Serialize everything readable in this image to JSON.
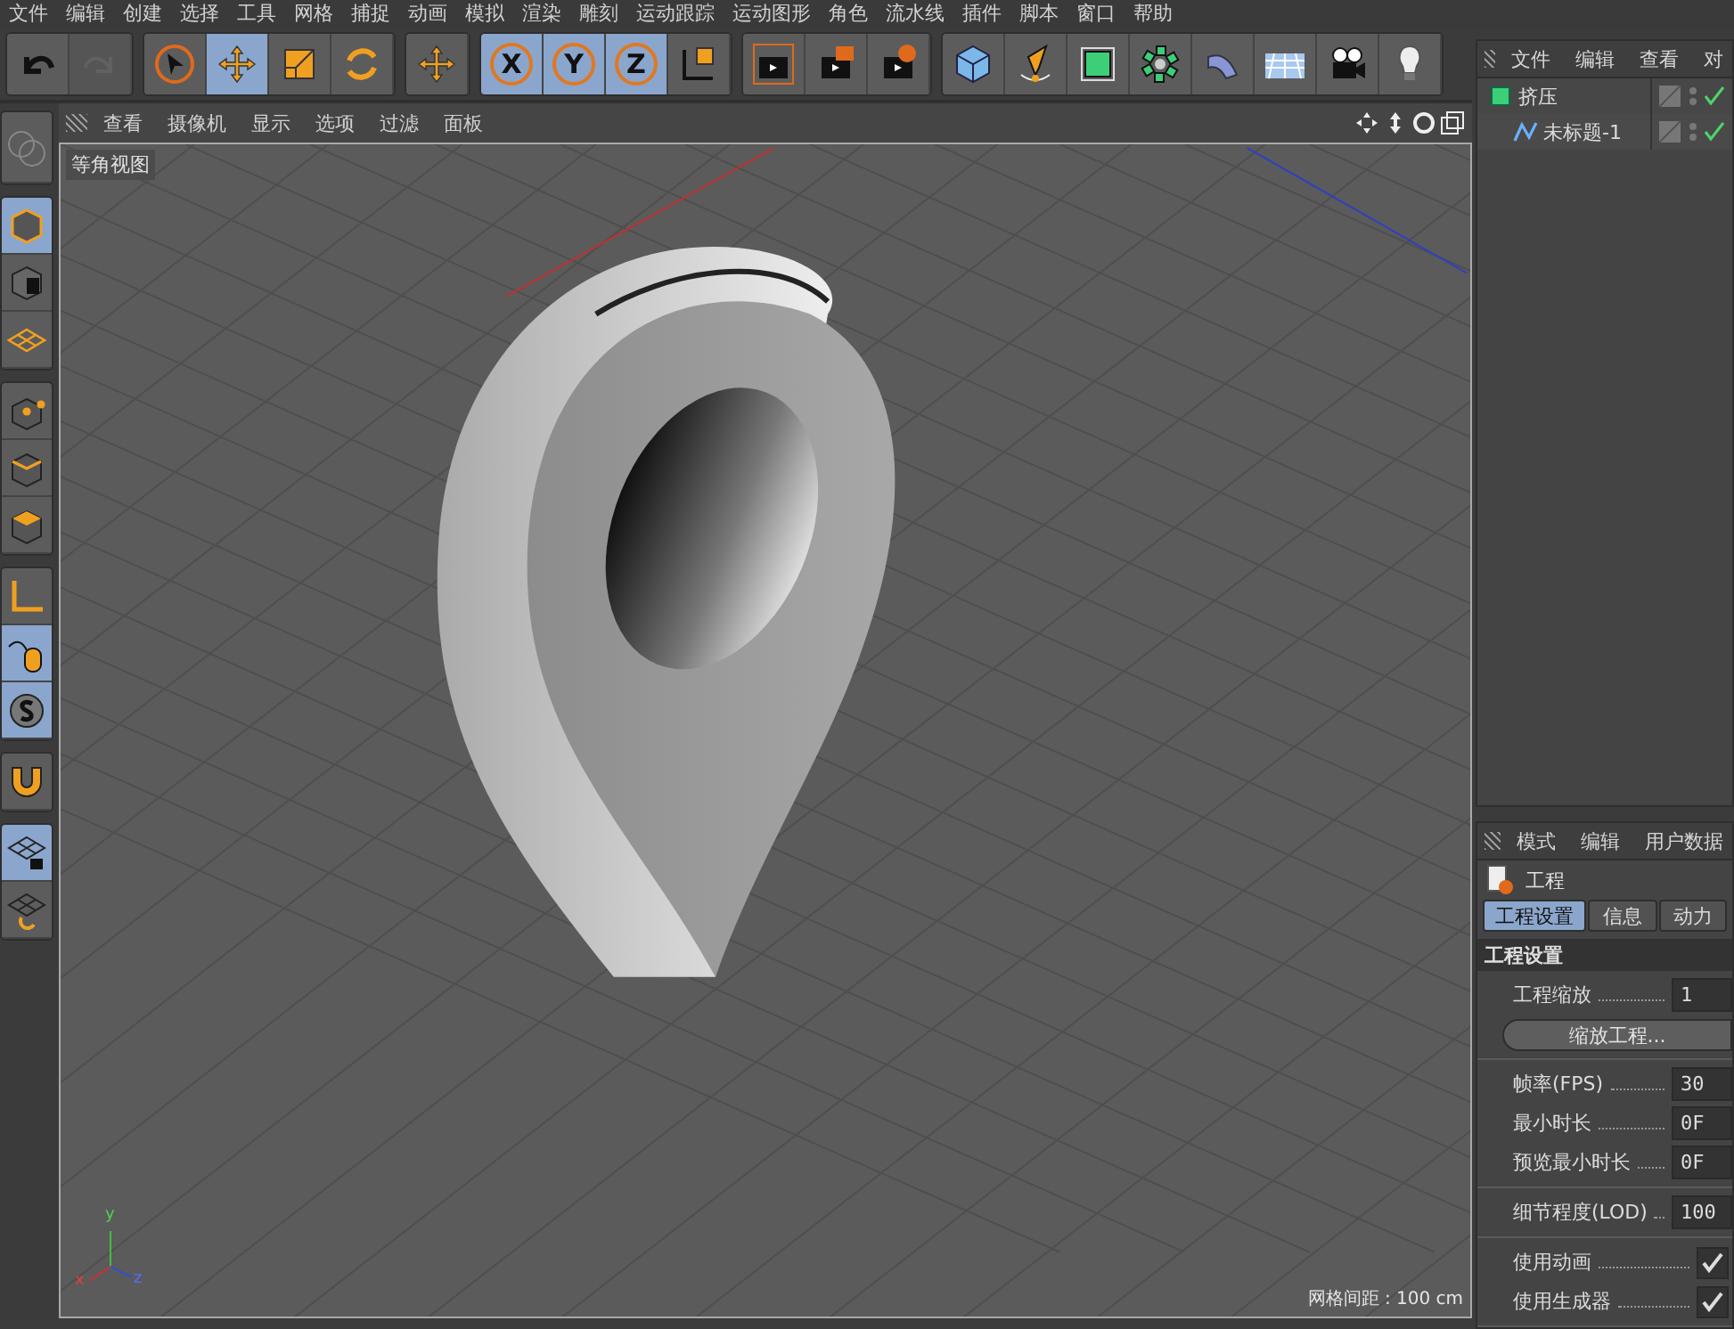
{
  "menu_bar": [
    "文件",
    "编辑",
    "创建",
    "选择",
    "工具",
    "网格",
    "捕捉",
    "动画",
    "模拟",
    "渲染",
    "雕刻",
    "运动跟踪",
    "运动图形",
    "角色",
    "流水线",
    "插件",
    "脚本",
    "窗口",
    "帮助"
  ],
  "toolbar": {
    "groups": [
      {
        "items": [
          {
            "selected": false,
            "disabled": false
          },
          {
            "selected": false,
            "disabled": true
          }
        ]
      },
      {
        "items": [
          {
            "selected": false,
            "disabled": false
          },
          {
            "selected": true,
            "disabled": false
          },
          {
            "selected": false,
            "disabled": false
          },
          {
            "selected": false,
            "disabled": false
          }
        ]
      },
      {
        "items": [
          {
            "selected": false,
            "disabled": false
          }
        ]
      },
      {
        "items": [
          {
            "selected": true,
            "disabled": false,
            "label": "X"
          },
          {
            "selected": true,
            "disabled": false,
            "label": "Y"
          },
          {
            "selected": true,
            "disabled": false,
            "label": "Z"
          },
          {
            "selected": false,
            "disabled": false
          }
        ]
      },
      {
        "items": [
          {
            "selected": false,
            "disabled": false
          },
          {
            "selected": false,
            "disabled": false
          },
          {
            "selected": false,
            "disabled": false
          }
        ]
      },
      {
        "items": [
          {
            "selected": false,
            "disabled": false
          },
          {
            "selected": false,
            "disabled": false
          },
          {
            "selected": false,
            "disabled": false
          },
          {
            "selected": false,
            "disabled": false
          },
          {
            "selected": false,
            "disabled": false
          },
          {
            "selected": false,
            "disabled": false
          },
          {
            "selected": false,
            "disabled": false
          },
          {
            "selected": false,
            "disabled": false
          }
        ]
      }
    ]
  },
  "left_toolbar": {
    "groups": [
      {
        "items": [
          {
            "selected": false
          }
        ]
      },
      {
        "items": [
          {
            "selected": true
          },
          {
            "selected": false
          },
          {
            "selected": false
          }
        ]
      },
      {
        "items": [
          {
            "selected": false
          },
          {
            "selected": false
          },
          {
            "selected": false
          }
        ]
      },
      {
        "items": [
          {
            "selected": false
          },
          {
            "selected": true
          },
          {
            "selected": true
          }
        ]
      },
      {
        "items": [
          {
            "selected": false
          }
        ]
      },
      {
        "items": [
          {
            "selected": true
          },
          {
            "selected": false
          }
        ]
      }
    ]
  },
  "viewport": {
    "menu": [
      "查看",
      "摄像机",
      "显示",
      "选项",
      "过滤",
      "面板"
    ],
    "view_name": "等角视图",
    "grid_spacing": "网格间距 : 100 cm",
    "axis_labels": {
      "y": "y",
      "x": "x",
      "z": "z"
    }
  },
  "object_manager": {
    "menu": [
      "文件",
      "编辑",
      "查看",
      "对"
    ],
    "objects": [
      {
        "name": "挤压",
        "enabled": true,
        "children": [
          {
            "name": "未标题-1",
            "enabled": true
          }
        ]
      }
    ]
  },
  "attribute_manager": {
    "menu": [
      "模式",
      "编辑",
      "用户数据"
    ],
    "title": "工程",
    "tabs": [
      {
        "label": "工程设置",
        "selected": true
      },
      {
        "label": "信息",
        "selected": false
      },
      {
        "label": "动力",
        "selected": false
      }
    ],
    "section": "工程设置",
    "groups": [
      [
        {
          "kind": "number",
          "label": "工程缩放",
          "value": "1"
        },
        {
          "kind": "button",
          "label": "缩放工程..."
        }
      ],
      [
        {
          "kind": "number",
          "label": "帧率(FPS)",
          "value": "30"
        },
        {
          "kind": "number",
          "label": "最小时长",
          "value": "0F"
        },
        {
          "kind": "number",
          "label": "预览最小时长",
          "value": "0F"
        }
      ],
      [
        {
          "kind": "number",
          "label": "细节程度(LOD)",
          "value": "100"
        }
      ],
      [
        {
          "kind": "checkbox",
          "label": "使用动画",
          "checked": true
        },
        {
          "kind": "checkbox",
          "label": "使用生成器",
          "checked": true
        }
      ]
    ]
  }
}
